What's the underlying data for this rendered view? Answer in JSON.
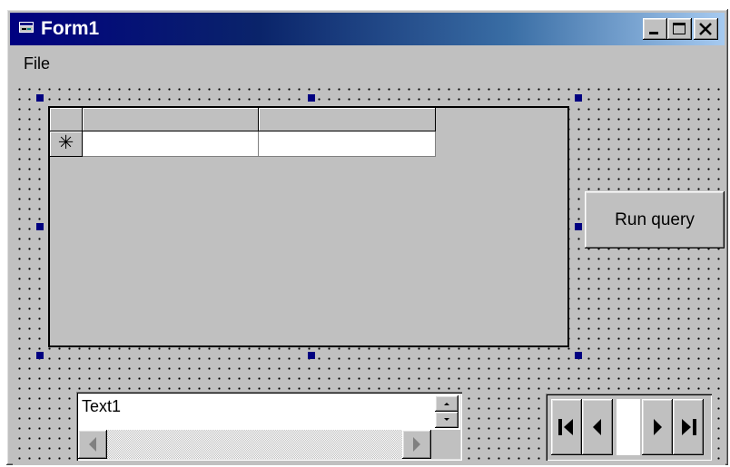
{
  "window": {
    "title": "Form1",
    "controls": [
      "minimize-icon",
      "maximize-icon",
      "close-icon"
    ]
  },
  "menu": {
    "items": [
      "File"
    ]
  },
  "form": {
    "datagrid": {
      "columns": [
        "",
        ""
      ],
      "new_row_marker": "✳",
      "rows": [
        [
          "",
          ""
        ]
      ]
    },
    "run_button_label": "Run query",
    "textbox": {
      "value": "Text1"
    },
    "data_control": {
      "caption": "",
      "buttons": [
        "first-record-icon",
        "previous-record-icon",
        "next-record-icon",
        "last-record-icon"
      ]
    }
  }
}
